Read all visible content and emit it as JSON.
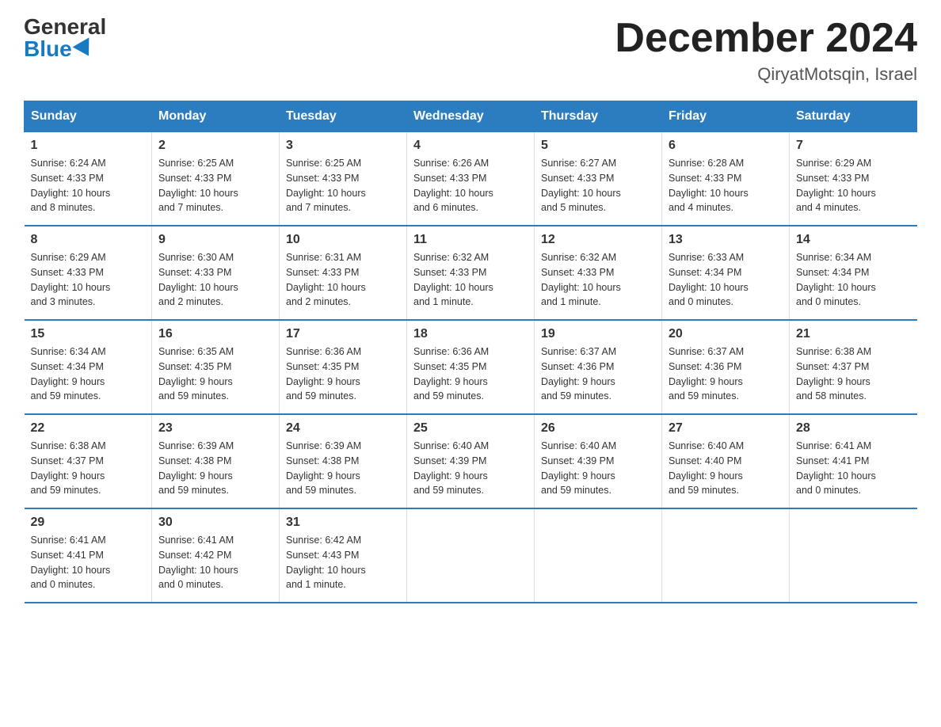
{
  "header": {
    "logo_general": "General",
    "logo_blue": "Blue",
    "month_title": "December 2024",
    "location": "QiryatMotsqin, Israel"
  },
  "days_of_week": [
    "Sunday",
    "Monday",
    "Tuesday",
    "Wednesday",
    "Thursday",
    "Friday",
    "Saturday"
  ],
  "weeks": [
    [
      {
        "day": "1",
        "sunrise": "6:24 AM",
        "sunset": "4:33 PM",
        "daylight": "10 hours and 8 minutes."
      },
      {
        "day": "2",
        "sunrise": "6:25 AM",
        "sunset": "4:33 PM",
        "daylight": "10 hours and 7 minutes."
      },
      {
        "day": "3",
        "sunrise": "6:25 AM",
        "sunset": "4:33 PM",
        "daylight": "10 hours and 7 minutes."
      },
      {
        "day": "4",
        "sunrise": "6:26 AM",
        "sunset": "4:33 PM",
        "daylight": "10 hours and 6 minutes."
      },
      {
        "day": "5",
        "sunrise": "6:27 AM",
        "sunset": "4:33 PM",
        "daylight": "10 hours and 5 minutes."
      },
      {
        "day": "6",
        "sunrise": "6:28 AM",
        "sunset": "4:33 PM",
        "daylight": "10 hours and 4 minutes."
      },
      {
        "day": "7",
        "sunrise": "6:29 AM",
        "sunset": "4:33 PM",
        "daylight": "10 hours and 4 minutes."
      }
    ],
    [
      {
        "day": "8",
        "sunrise": "6:29 AM",
        "sunset": "4:33 PM",
        "daylight": "10 hours and 3 minutes."
      },
      {
        "day": "9",
        "sunrise": "6:30 AM",
        "sunset": "4:33 PM",
        "daylight": "10 hours and 2 minutes."
      },
      {
        "day": "10",
        "sunrise": "6:31 AM",
        "sunset": "4:33 PM",
        "daylight": "10 hours and 2 minutes."
      },
      {
        "day": "11",
        "sunrise": "6:32 AM",
        "sunset": "4:33 PM",
        "daylight": "10 hours and 1 minute."
      },
      {
        "day": "12",
        "sunrise": "6:32 AM",
        "sunset": "4:33 PM",
        "daylight": "10 hours and 1 minute."
      },
      {
        "day": "13",
        "sunrise": "6:33 AM",
        "sunset": "4:34 PM",
        "daylight": "10 hours and 0 minutes."
      },
      {
        "day": "14",
        "sunrise": "6:34 AM",
        "sunset": "4:34 PM",
        "daylight": "10 hours and 0 minutes."
      }
    ],
    [
      {
        "day": "15",
        "sunrise": "6:34 AM",
        "sunset": "4:34 PM",
        "daylight": "9 hours and 59 minutes."
      },
      {
        "day": "16",
        "sunrise": "6:35 AM",
        "sunset": "4:35 PM",
        "daylight": "9 hours and 59 minutes."
      },
      {
        "day": "17",
        "sunrise": "6:36 AM",
        "sunset": "4:35 PM",
        "daylight": "9 hours and 59 minutes."
      },
      {
        "day": "18",
        "sunrise": "6:36 AM",
        "sunset": "4:35 PM",
        "daylight": "9 hours and 59 minutes."
      },
      {
        "day": "19",
        "sunrise": "6:37 AM",
        "sunset": "4:36 PM",
        "daylight": "9 hours and 59 minutes."
      },
      {
        "day": "20",
        "sunrise": "6:37 AM",
        "sunset": "4:36 PM",
        "daylight": "9 hours and 59 minutes."
      },
      {
        "day": "21",
        "sunrise": "6:38 AM",
        "sunset": "4:37 PM",
        "daylight": "9 hours and 58 minutes."
      }
    ],
    [
      {
        "day": "22",
        "sunrise": "6:38 AM",
        "sunset": "4:37 PM",
        "daylight": "9 hours and 59 minutes."
      },
      {
        "day": "23",
        "sunrise": "6:39 AM",
        "sunset": "4:38 PM",
        "daylight": "9 hours and 59 minutes."
      },
      {
        "day": "24",
        "sunrise": "6:39 AM",
        "sunset": "4:38 PM",
        "daylight": "9 hours and 59 minutes."
      },
      {
        "day": "25",
        "sunrise": "6:40 AM",
        "sunset": "4:39 PM",
        "daylight": "9 hours and 59 minutes."
      },
      {
        "day": "26",
        "sunrise": "6:40 AM",
        "sunset": "4:39 PM",
        "daylight": "9 hours and 59 minutes."
      },
      {
        "day": "27",
        "sunrise": "6:40 AM",
        "sunset": "4:40 PM",
        "daylight": "9 hours and 59 minutes."
      },
      {
        "day": "28",
        "sunrise": "6:41 AM",
        "sunset": "4:41 PM",
        "daylight": "10 hours and 0 minutes."
      }
    ],
    [
      {
        "day": "29",
        "sunrise": "6:41 AM",
        "sunset": "4:41 PM",
        "daylight": "10 hours and 0 minutes."
      },
      {
        "day": "30",
        "sunrise": "6:41 AM",
        "sunset": "4:42 PM",
        "daylight": "10 hours and 0 minutes."
      },
      {
        "day": "31",
        "sunrise": "6:42 AM",
        "sunset": "4:43 PM",
        "daylight": "10 hours and 1 minute."
      },
      null,
      null,
      null,
      null
    ]
  ]
}
